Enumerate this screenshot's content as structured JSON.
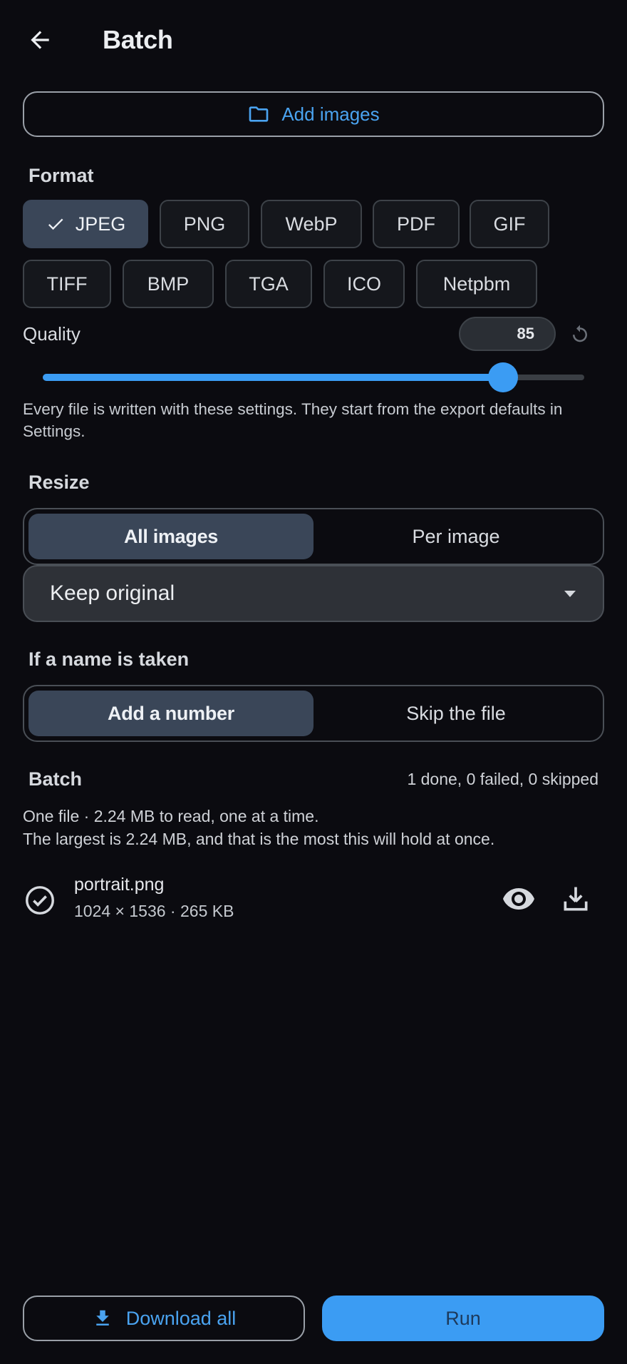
{
  "header": {
    "title": "Batch",
    "back_icon": "arrow-left-icon"
  },
  "add_images": {
    "label": "Add images",
    "icon": "folder-icon"
  },
  "format": {
    "label": "Format",
    "selected": "JPEG",
    "options": [
      "JPEG",
      "PNG",
      "WebP",
      "PDF",
      "GIF",
      "TIFF",
      "BMP",
      "TGA",
      "ICO",
      "Netpbm"
    ]
  },
  "quality": {
    "label": "Quality",
    "value": "85",
    "min": 0,
    "max": 100
  },
  "help_text": "Every file is written with these settings. They start from the export defaults in Settings.",
  "resize": {
    "label": "Resize",
    "modes": [
      "All images",
      "Per image"
    ],
    "active_mode": "All images",
    "dropdown_value": "Keep original"
  },
  "conflict": {
    "label": "If a name is taken",
    "modes": [
      "Add a number",
      "Skip the file"
    ],
    "active_mode": "Add a number"
  },
  "batch": {
    "label": "Batch",
    "status": "1 done, 0 failed, 0 skipped",
    "info_line1": "One file · 2.24 MB to read, one at a time.",
    "info_line2": "The largest is 2.24 MB, and that is the most this will hold at once.",
    "files": [
      {
        "name": "portrait.png",
        "meta": "1024 × 1536 · 265 KB",
        "status": "done"
      }
    ]
  },
  "actions": {
    "download_all": "Download all",
    "run": "Run"
  },
  "colors": {
    "accent": "#3b9cf3",
    "selected_chip": "#3a4658",
    "background": "#0b0b10"
  }
}
